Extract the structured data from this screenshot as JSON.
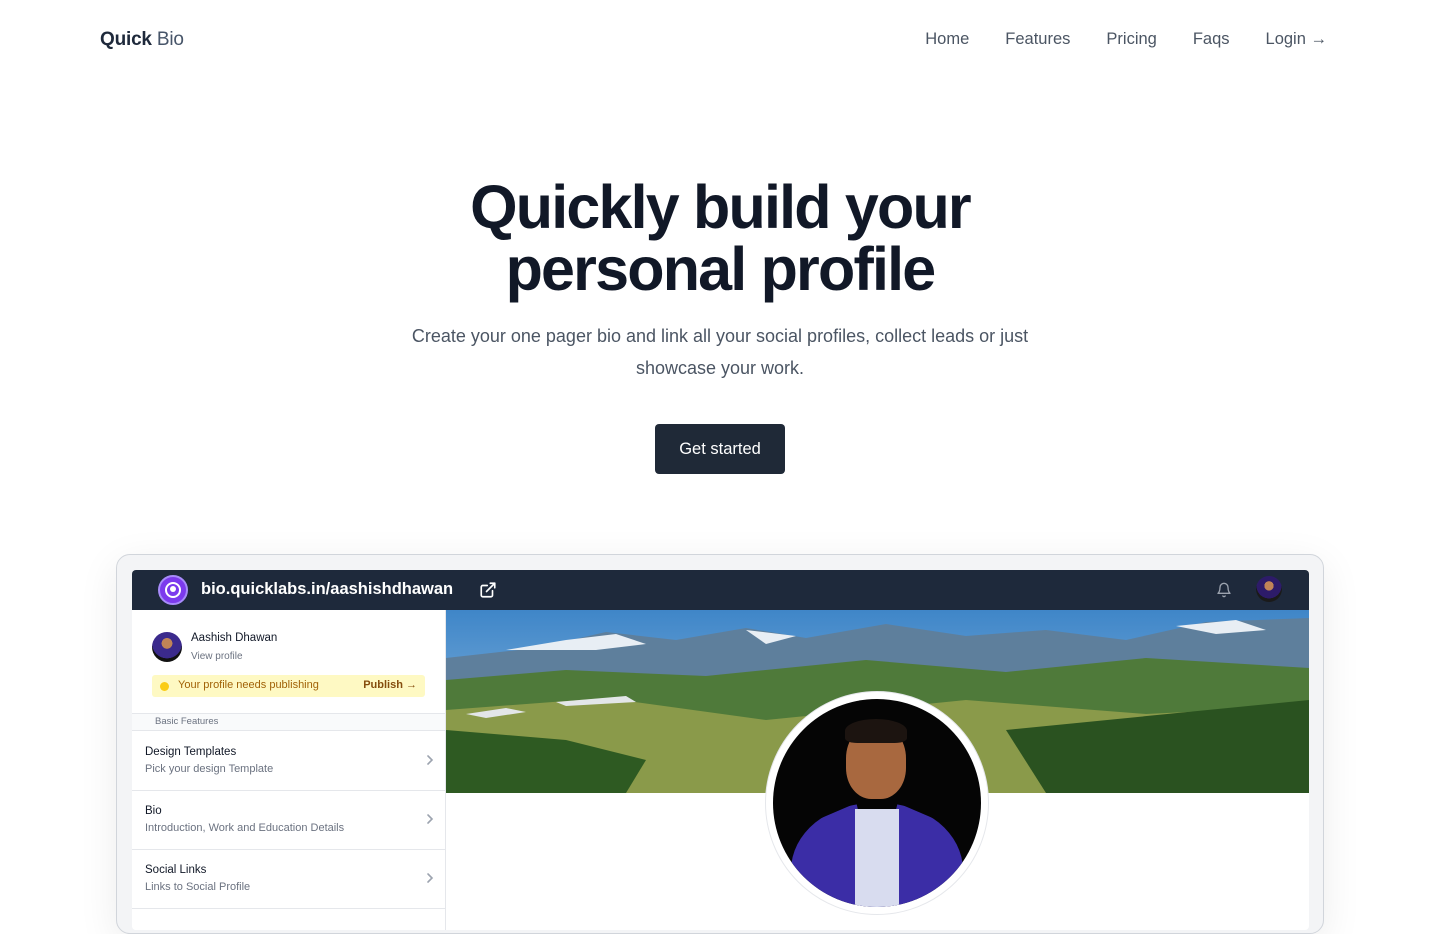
{
  "nav": {
    "logo_bold": "Quick",
    "logo_light": "Bio",
    "links": [
      "Home",
      "Features",
      "Pricing",
      "Faqs",
      "Login →"
    ]
  },
  "hero": {
    "title_line1": "Quickly build your",
    "title_line2": "personal profile",
    "subtitle": "Create your one pager bio and link all your social profiles, collect leads or just showcase your work.",
    "cta": "Get started"
  },
  "app": {
    "url": "bio.quicklabs.in/aashishdhawan",
    "user_name": "Aashish Dhawan",
    "view_profile": "View profile",
    "notice_text": "Your profile needs publishing",
    "publish_label": "Publish →",
    "section_label": "Basic Features",
    "menu": [
      {
        "title": "Design Templates",
        "subtitle": "Pick your design Template"
      },
      {
        "title": "Bio",
        "subtitle": "Introduction, Work and Education Details"
      },
      {
        "title": "Social Links",
        "subtitle": "Links to Social Profile"
      }
    ]
  },
  "colors": {
    "primary_dark": "#1f2937",
    "app_bar": "#1e293b",
    "accent_purple": "#7c3aed",
    "notice_bg": "#fef9c3"
  }
}
